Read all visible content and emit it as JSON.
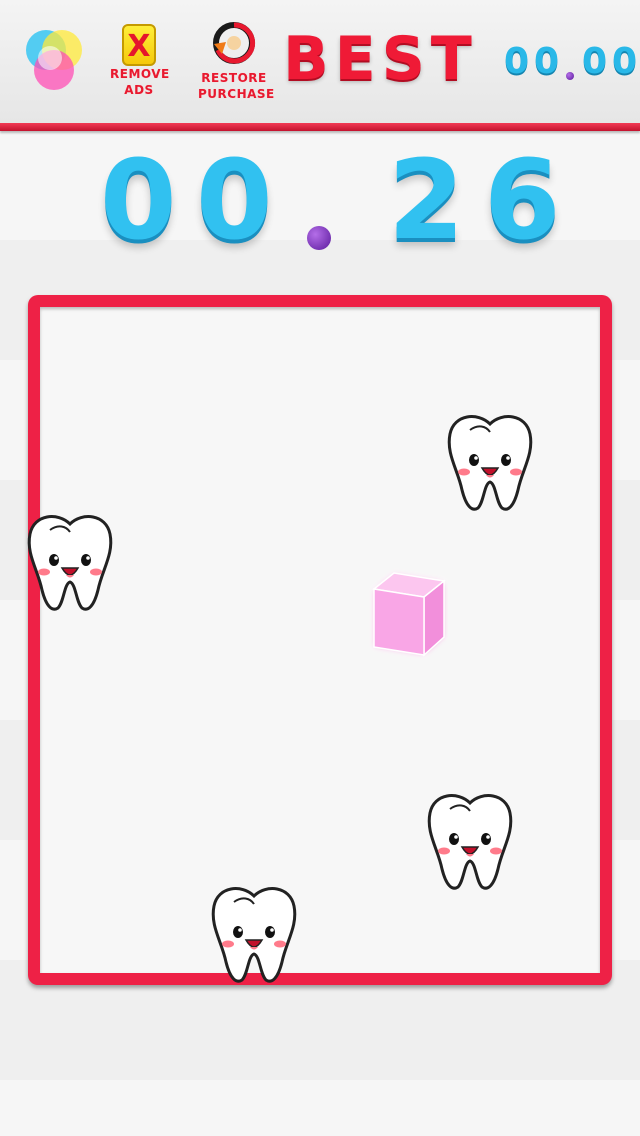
{
  "toolbar": {
    "remove_ads_label": "REMOVE\nADS",
    "remove_ads_icon": "X",
    "restore_label": "RESTORE\nPURCHASE"
  },
  "best": {
    "label": "BEST",
    "value_digits": [
      "0",
      "0",
      "0",
      "0"
    ]
  },
  "timer": {
    "digits": [
      "0",
      "0",
      "2",
      "6"
    ]
  },
  "colors": {
    "accent_red": "#ee2146",
    "digit_blue": "#31c1f0",
    "dot_purple": "#6a22b0",
    "cube_pink": "#f9a6e6"
  },
  "icons": {
    "theme": "color-circles-icon",
    "restore": "restore-arrow-icon",
    "cube": "pink-cube-player",
    "tooth": "smiling-tooth-enemy"
  }
}
